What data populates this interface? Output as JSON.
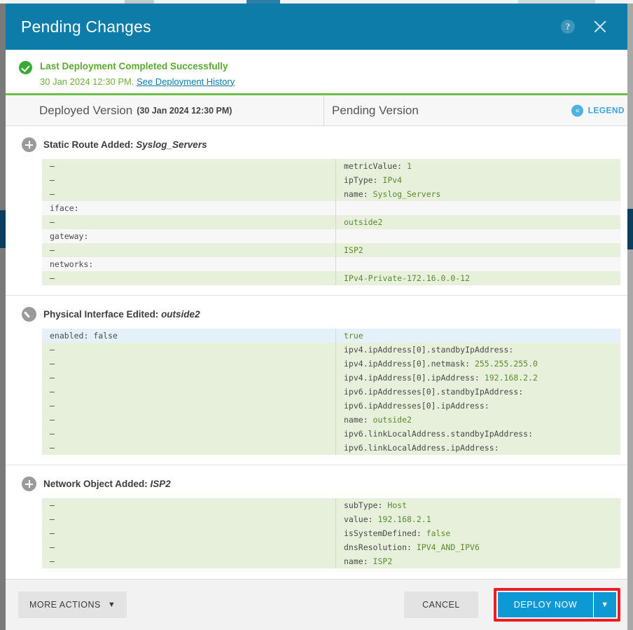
{
  "window": {
    "title": "Pending Changes",
    "help_icon": "help-circle-icon",
    "close_icon": "close-icon"
  },
  "banner": {
    "icon": "success-check-icon",
    "title": "Last Deployment Completed Successfully",
    "timestamp": "30 Jan 2024 12:30 PM.",
    "link_label": "See Deployment History"
  },
  "columns": {
    "deployed_title": "Deployed Version",
    "deployed_sub": "(30 Jan 2024 12:30 PM)",
    "pending_title": "Pending Version",
    "legend_icon": "double-chevron-left-icon",
    "legend_label": "LEGEND"
  },
  "colors": {
    "titlebar": "#0d7ca8",
    "banner_green": "#6cbe45",
    "row_added": "#e6f0da",
    "row_modified": "#e4f1f9",
    "row_neutral": "#f7f7f7",
    "value_green": "#5c8b2e",
    "deploy_blue": "#0d9ad4",
    "highlight_red": "#ee1d24",
    "legend_blue": "#3aa5dd"
  },
  "sections": [
    {
      "icon": "plus-circle-icon",
      "label": "Static Route Added:",
      "object": "Syslog_Servers",
      "rows": [
        {
          "state": "added",
          "left": "–",
          "right_key": "metricValue:",
          "right_val": "1"
        },
        {
          "state": "added",
          "left": "–",
          "right_key": "ipType:",
          "right_val": "IPv4"
        },
        {
          "state": "added",
          "left": "–",
          "right_key": "name:",
          "right_val": "Syslog_Servers"
        },
        {
          "state": "neutral",
          "left": "iface:",
          "right_key": "",
          "right_val": ""
        },
        {
          "state": "added",
          "left": "–",
          "right_key": "",
          "right_val": "outside2"
        },
        {
          "state": "neutral",
          "left": "gateway:",
          "right_key": "",
          "right_val": ""
        },
        {
          "state": "added",
          "left": "–",
          "right_key": "",
          "right_val": "ISP2"
        },
        {
          "state": "neutral",
          "left": "networks:",
          "right_key": "",
          "right_val": ""
        },
        {
          "state": "added",
          "left": "–",
          "right_key": "",
          "right_val": "IPv4-Private-172.16.0.0-12"
        }
      ]
    },
    {
      "icon": "pencil-circle-icon",
      "label": "Physical Interface Edited:",
      "object": "outside2",
      "rows": [
        {
          "state": "modified",
          "left_key": "enabled:",
          "left_val": "false",
          "left": "",
          "right_key": "",
          "right_val": "true"
        },
        {
          "state": "added",
          "left": "–",
          "right_key": "ipv4.ipAddress[0].standbyIpAddress:",
          "right_val": ""
        },
        {
          "state": "added",
          "left": "–",
          "right_key": "ipv4.ipAddress[0].netmask:",
          "right_val": "255.255.255.0"
        },
        {
          "state": "added",
          "left": "–",
          "right_key": "ipv4.ipAddress[0].ipAddress:",
          "right_val": "192.168.2.2"
        },
        {
          "state": "added",
          "left": "–",
          "right_key": "ipv6.ipAddresses[0].standbyIpAddress:",
          "right_val": ""
        },
        {
          "state": "added",
          "left": "–",
          "right_key": "ipv6.ipAddresses[0].ipAddress:",
          "right_val": ""
        },
        {
          "state": "added",
          "left": "–",
          "right_key": "name:",
          "right_val": "outside2"
        },
        {
          "state": "added",
          "left": "–",
          "right_key": "ipv6.linkLocalAddress.standbyIpAddress:",
          "right_val": ""
        },
        {
          "state": "added",
          "left": "–",
          "right_key": "ipv6.linkLocalAddress.ipAddress:",
          "right_val": ""
        }
      ]
    },
    {
      "icon": "plus-circle-icon",
      "label": "Network Object Added:",
      "object": "ISP2",
      "rows": [
        {
          "state": "added",
          "left": "–",
          "right_key": "subType:",
          "right_val": "Host"
        },
        {
          "state": "added",
          "left": "–",
          "right_key": "value:",
          "right_val": "192.168.2.1"
        },
        {
          "state": "added",
          "left": "–",
          "right_key": "isSystemDefined:",
          "right_val": "false"
        },
        {
          "state": "added",
          "left": "–",
          "right_key": "dnsResolution:",
          "right_val": "IPV4_AND_IPV6"
        },
        {
          "state": "added",
          "left": "–",
          "right_key": "name:",
          "right_val": "ISP2"
        }
      ]
    }
  ],
  "footer": {
    "more_actions_label": "MORE ACTIONS",
    "more_actions_caret": "chevron-down-icon",
    "cancel_label": "CANCEL",
    "deploy_label": "DEPLOY NOW",
    "deploy_caret": "chevron-down-icon"
  }
}
